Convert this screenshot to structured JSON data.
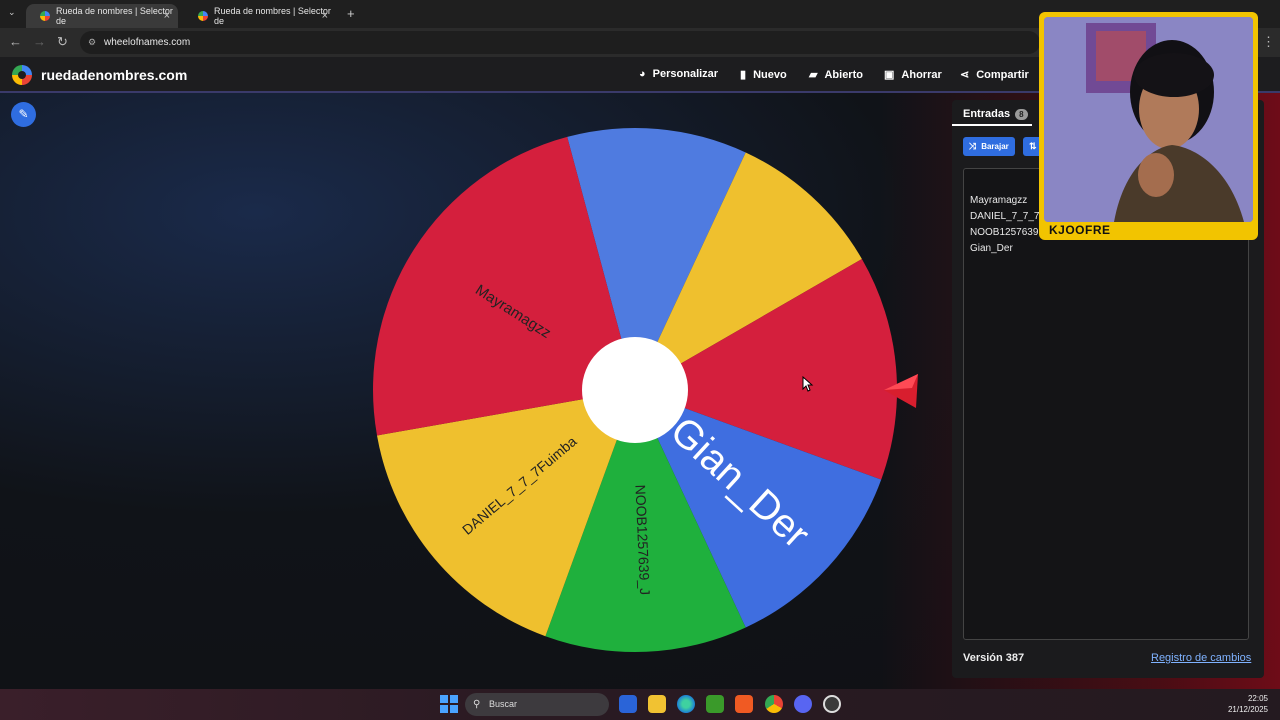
{
  "browser": {
    "tabs": [
      {
        "title": "Rueda de nombres | Selector de"
      },
      {
        "title": "Rueda de nombres | Selector de"
      }
    ],
    "url": "wheelofnames.com"
  },
  "header": {
    "site_name": "ruedadenombres.com",
    "nav": [
      {
        "label": "Personalizar",
        "icon": "palette-icon"
      },
      {
        "label": "Nuevo",
        "icon": "file-icon"
      },
      {
        "label": "Abierto",
        "icon": "folder-icon"
      },
      {
        "label": "Ahorrar",
        "icon": "save-icon"
      },
      {
        "label": "Compartir",
        "icon": "share-icon"
      }
    ]
  },
  "wheel": {
    "segments": [
      {
        "label": "",
        "color": "#4f7be0"
      },
      {
        "label": "",
        "color": "#efc02e"
      },
      {
        "label": "",
        "color": "#d41f3d"
      },
      {
        "label": "Gian_Der",
        "color": "#3f6ee0"
      },
      {
        "label": "NOOB1257639_J",
        "color": "#1fb03d"
      },
      {
        "label": "DANIEL_7_7_7Fuimba",
        "color": "#efc02e"
      },
      {
        "label": "Mayramagzz",
        "color": "#d41f3d"
      }
    ]
  },
  "sidebar": {
    "tab_label": "Entradas",
    "entries_count": "8",
    "shuffle_label": "Barajar",
    "entries": [
      "Mayramagzz",
      "DANIEL_7_7_7F",
      "NOOB1257639",
      "Gian_Der"
    ],
    "version": "Versión 387",
    "changelog": "Registro de cambios"
  },
  "webcam": {
    "name": "KJOOFRE"
  },
  "taskbar": {
    "search_label": "Buscar",
    "time": "22:05",
    "date": "21/12/2025"
  }
}
